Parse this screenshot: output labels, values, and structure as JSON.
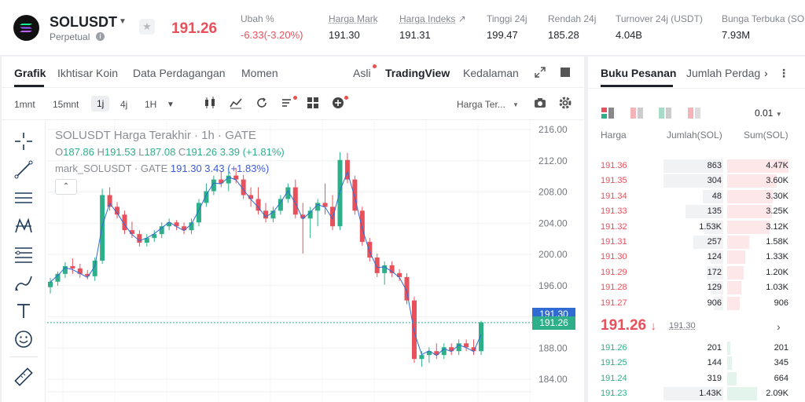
{
  "header": {
    "symbol": "SOLUSDT",
    "contract_type": "Perpetual",
    "last_price": "191.26",
    "stats": [
      {
        "label": "Ubah %",
        "value": "-6.33(-3.20%)",
        "tone": "red"
      },
      {
        "label": "Harga Mark",
        "value": "191.30",
        "tone": "normal"
      },
      {
        "label": "Harga Indeks",
        "value": "191.31",
        "tone": "normal"
      },
      {
        "label": "Tinggi 24j",
        "value": "199.47",
        "tone": "normal"
      },
      {
        "label": "Rendah 24j",
        "value": "185.28",
        "tone": "normal"
      },
      {
        "label": "Turnover 24j (USDT)",
        "value": "4.04B",
        "tone": "normal"
      },
      {
        "label": "Bunga Terbuka (SO",
        "value": "7.93M",
        "tone": "normal"
      }
    ]
  },
  "chart_tabs": [
    "Grafik",
    "Ikhtisar Koin",
    "Data Perdagangan",
    "Momen"
  ],
  "chart_modes": [
    "Asli",
    "TradingView",
    "Kedalaman"
  ],
  "toolbar": {
    "intervals": [
      "1mnt",
      "15mnt",
      "1j",
      "4j",
      "1H"
    ],
    "selected_interval": "1j",
    "price_type": "Harga Ter..."
  },
  "legend": {
    "title": "SOLUSDT Harga Terakhir · 1h · GATE",
    "ohlc": {
      "o_label": "O",
      "o": "187.86",
      "h_label": "H",
      "h": "191.53",
      "l_label": "L",
      "l": "187.08",
      "c_label": "C",
      "c": "191.26",
      "change": "3.39 (+1.81%)"
    },
    "mark_label": "mark_SOLUSDT · GATE",
    "mark_value": "191.30",
    "mark_change": "3.43 (+1.83%)"
  },
  "chart_data": {
    "type": "candlestick",
    "y_ticks": [
      "216.00",
      "212.00",
      "208.00",
      "204.00",
      "200.00",
      "196.00",
      "192.00",
      "188.00",
      "184.00"
    ],
    "ylim": [
      183,
      217
    ],
    "mark_price_tag": "191.30",
    "last_price_tag": "191.26",
    "candles": [
      [
        195.8,
        197.0,
        195.0,
        196.5
      ],
      [
        196.5,
        197.8,
        196.0,
        197.5
      ],
      [
        197.5,
        199.0,
        197.0,
        198.5
      ],
      [
        198.5,
        199.5,
        197.5,
        198.2
      ],
      [
        198.2,
        198.8,
        197.0,
        197.5
      ],
      [
        197.5,
        198.0,
        196.8,
        197.2
      ],
      [
        197.2,
        199.6,
        196.6,
        199.2
      ],
      [
        199.2,
        208.4,
        198.8,
        207.6
      ],
      [
        207.6,
        208.6,
        205.6,
        206.1
      ],
      [
        206.1,
        206.7,
        204.6,
        205.1
      ],
      [
        205.1,
        205.6,
        202.6,
        203.1
      ],
      [
        203.1,
        204.2,
        202.1,
        202.6
      ],
      [
        202.6,
        203.1,
        201.0,
        201.5
      ],
      [
        201.5,
        202.6,
        201.0,
        202.1
      ],
      [
        202.1,
        203.1,
        201.6,
        202.6
      ],
      [
        202.6,
        204.1,
        202.1,
        203.6
      ],
      [
        203.6,
        204.6,
        203.1,
        204.1
      ],
      [
        204.1,
        204.4,
        203.1,
        203.6
      ],
      [
        203.6,
        204.1,
        202.6,
        203.1
      ],
      [
        203.1,
        204.6,
        202.6,
        204.1
      ],
      [
        204.1,
        207.1,
        203.6,
        206.6
      ],
      [
        206.6,
        209.1,
        206.1,
        208.1
      ],
      [
        208.1,
        210.1,
        207.6,
        209.6
      ],
      [
        209.6,
        210.6,
        208.6,
        209.1
      ],
      [
        209.1,
        210.6,
        208.1,
        210.1
      ],
      [
        210.1,
        211.1,
        209.1,
        209.6
      ],
      [
        209.6,
        210.2,
        207.1,
        207.6
      ],
      [
        207.6,
        208.6,
        206.1,
        207.1
      ],
      [
        207.1,
        208.6,
        205.1,
        205.6
      ],
      [
        205.6,
        206.6,
        204.1,
        204.6
      ],
      [
        204.6,
        206.1,
        204.1,
        205.6
      ],
      [
        205.6,
        207.6,
        205.1,
        207.1
      ],
      [
        207.1,
        209.1,
        206.6,
        208.6
      ],
      [
        208.6,
        209.6,
        204.6,
        205.1
      ],
      [
        205.1,
        206.6,
        200.1,
        204.6
      ],
      [
        204.6,
        206.1,
        202.1,
        205.6
      ],
      [
        205.6,
        207.1,
        203.6,
        206.6
      ],
      [
        206.6,
        209.1,
        205.1,
        206.1
      ],
      [
        206.1,
        207.6,
        203.1,
        203.6
      ],
      [
        203.6,
        213.1,
        203.1,
        212.1
      ],
      [
        212.1,
        213.0,
        209.1,
        209.6
      ],
      [
        209.6,
        210.1,
        205.1,
        205.6
      ],
      [
        205.6,
        206.1,
        201.1,
        201.6
      ],
      [
        201.6,
        202.1,
        199.1,
        199.6
      ],
      [
        199.6,
        200.1,
        197.1,
        197.6
      ],
      [
        197.6,
        199.1,
        196.1,
        198.6
      ],
      [
        198.6,
        199.1,
        197.1,
        197.6
      ],
      [
        197.6,
        198.1,
        196.6,
        197.1
      ],
      [
        197.1,
        197.6,
        193.6,
        194.1
      ],
      [
        194.1,
        194.6,
        186.1,
        186.6
      ],
      [
        186.6,
        187.6,
        185.6,
        187.1
      ],
      [
        187.1,
        188.1,
        186.1,
        187.6
      ],
      [
        187.6,
        188.6,
        186.6,
        187.1
      ],
      [
        187.1,
        188.6,
        186.6,
        188.1
      ],
      [
        188.1,
        188.6,
        187.1,
        187.6
      ],
      [
        187.6,
        189.1,
        187.1,
        188.6
      ],
      [
        188.6,
        189.1,
        187.6,
        188.1
      ],
      [
        188.1,
        189.1,
        187.1,
        187.6
      ],
      [
        187.6,
        191.5,
        187.1,
        191.3
      ]
    ]
  },
  "order_book": {
    "tabs": [
      "Buku Pesanan",
      "Jumlah Perdag"
    ],
    "precision": "0.01",
    "headers": {
      "price": "Harga",
      "amount": "Jumlah(SOL)",
      "sum": "Sum(SOL)"
    },
    "asks": [
      {
        "price": "191.36",
        "amount": "863",
        "sum": "4.47K",
        "amt_frac": 0.95,
        "sum_frac": 0.98
      },
      {
        "price": "191.35",
        "amount": "304",
        "sum": "3.60K",
        "amt_frac": 0.95,
        "sum_frac": 0.79
      },
      {
        "price": "191.34",
        "amount": "48",
        "sum": "3.30K",
        "amt_frac": 0.32,
        "sum_frac": 0.72
      },
      {
        "price": "191.33",
        "amount": "135",
        "sum": "3.25K",
        "amt_frac": 0.6,
        "sum_frac": 0.71
      },
      {
        "price": "191.32",
        "amount": "1.53K",
        "sum": "3.12K",
        "amt_frac": 0.3,
        "sum_frac": 0.68
      },
      {
        "price": "191.31",
        "amount": "257",
        "sum": "1.58K",
        "amt_frac": 0.48,
        "sum_frac": 0.35
      },
      {
        "price": "191.30",
        "amount": "124",
        "sum": "1.33K",
        "amt_frac": 0.2,
        "sum_frac": 0.29
      },
      {
        "price": "191.29",
        "amount": "172",
        "sum": "1.20K",
        "amt_frac": 0.26,
        "sum_frac": 0.26
      },
      {
        "price": "191.28",
        "amount": "129",
        "sum": "1.03K",
        "amt_frac": 0.2,
        "sum_frac": 0.23
      },
      {
        "price": "191.27",
        "amount": "906",
        "sum": "906",
        "amt_frac": 0.15,
        "sum_frac": 0.2
      }
    ],
    "mid_price": "191.26",
    "mid_arrow": "↓",
    "mid_mark": "191.30",
    "bids": [
      {
        "price": "191.26",
        "amount": "201",
        "sum": "201",
        "amt_frac": 0.0,
        "sum_frac": 0.05
      },
      {
        "price": "191.25",
        "amount": "144",
        "sum": "345",
        "amt_frac": 0.0,
        "sum_frac": 0.08
      },
      {
        "price": "191.24",
        "amount": "319",
        "sum": "664",
        "amt_frac": 0.0,
        "sum_frac": 0.15
      },
      {
        "price": "191.23",
        "amount": "1.43K",
        "sum": "2.09K",
        "amt_frac": 0.95,
        "sum_frac": 0.47
      }
    ]
  },
  "colors": {
    "up": "#2fae8a",
    "down": "#e8505b",
    "mark": "#2f6bd1"
  }
}
